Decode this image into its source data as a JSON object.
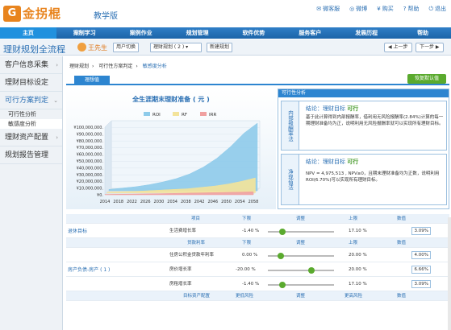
{
  "brand": {
    "name": "金拐棍",
    "edition": "教学版"
  },
  "toplinks": [
    "微客服",
    "微博",
    "购买",
    "帮助",
    "退出"
  ],
  "nav": [
    "主页",
    "案制学习",
    "案例作业",
    "规划管理",
    "软件优势",
    "服务客户",
    "发展历程",
    "帮助"
  ],
  "header": {
    "title": "理财规划全流程",
    "user": "王先生",
    "switch_user": "用户切换",
    "plan_select": "理财规划 ( 2 )",
    "new_plan": "新建规划",
    "prev": "上一步",
    "next": "下一步"
  },
  "sidebar": [
    {
      "label": "客户信息采集"
    },
    {
      "label": "理财目标设定"
    },
    {
      "label": "可行方案判定",
      "subs": [
        "可行性分析",
        "敏感度分析"
      ]
    },
    {
      "label": "理财资产配置"
    },
    {
      "label": "规划报告管理"
    }
  ],
  "breadcrumb": [
    "理财规划",
    "可行性方案判定",
    "敏感度分析"
  ],
  "tab": "理想值",
  "green_button": "恢复默认值",
  "chart_data": {
    "type": "area",
    "title": "全生涯期末理财准备 ( 元 )",
    "legend": [
      "ROI",
      "RF",
      "IRR"
    ],
    "x": [
      "2014",
      "2018",
      "2022",
      "2026",
      "2030",
      "2034",
      "2038",
      "2042",
      "2046",
      "2050",
      "2054",
      "2058"
    ],
    "ylabels": [
      "¥100,000,000.",
      "¥90,000,000.",
      "¥80,000,000.",
      "¥70,000,000.",
      "¥60,000,000.",
      "¥50,000,000.",
      "¥40,000,000.",
      "¥30,000,000.",
      "¥20,000,000.",
      "¥10,000,000.",
      "¥0."
    ],
    "series": [
      {
        "name": "ROI",
        "values": [
          2,
          4,
          6,
          9,
          13,
          18,
          25,
          35,
          48,
          65,
          85,
          100
        ],
        "color": "#8ecbea"
      },
      {
        "name": "RF",
        "values": [
          1,
          1.5,
          2,
          3,
          4,
          5,
          6,
          8,
          10,
          13,
          17,
          22
        ],
        "color": "#f3e39a"
      },
      {
        "name": "IRR",
        "values": [
          0.5,
          0.8,
          1,
          1.3,
          1.6,
          2,
          2.4,
          2.8,
          3.2,
          3.6,
          4,
          4.5
        ],
        "color": "#f0a0a0"
      }
    ],
    "ylim": [
      0,
      100000000
    ]
  },
  "feasibility": {
    "title": "可行性分析",
    "block1": {
      "label": "内部报酬率法",
      "conclusion": "结论：理财目标",
      "result": "可行",
      "text": "基于此计算得到内部报酬率，借利用无风险报酬率(2.84%)计算的每一期理财准备均为正，说明利用无风险报酬率就可以实现所有理财目标。"
    },
    "block2": {
      "label": "净现值法",
      "conclusion": "结论：理财目标",
      "result": "可行",
      "text": "NPV = 4,975,513 , NPV≥0，且期末理财准备均为正数，说明利用ROI(6.70%)可以实现所有理财目标。"
    }
  },
  "table": {
    "headers": [
      "项目",
      "下限",
      "调整",
      "上限",
      "数值"
    ],
    "rows": [
      {
        "group": "退休目标",
        "item": "生活费增长率",
        "low": "-1.40 %",
        "high": "17.10 %",
        "value": "3.09%",
        "pos": 0.25
      },
      {
        "subheader": [
          "贷款利率",
          "下限",
          "调整",
          "上限",
          "数值"
        ]
      },
      {
        "group": "房产负债-房产 ( 1 )",
        "item": "住房公积金贷款年利率",
        "low": "0.00 %",
        "high": "20.00 %",
        "value": "4.00%",
        "pos": 0.2
      },
      {
        "item": "房价增长率",
        "low": "-20.00 %",
        "high": "20.00 %",
        "value": "6.66%",
        "pos": 0.65
      },
      {
        "item": "房租增长率",
        "low": "-1.40 %",
        "high": "17.10 %",
        "value": "3.09%",
        "pos": 0.25
      },
      {
        "subheader": [
          "目标资产配置",
          "更低风险",
          "调整",
          "更高风险",
          "数值"
        ]
      }
    ]
  }
}
